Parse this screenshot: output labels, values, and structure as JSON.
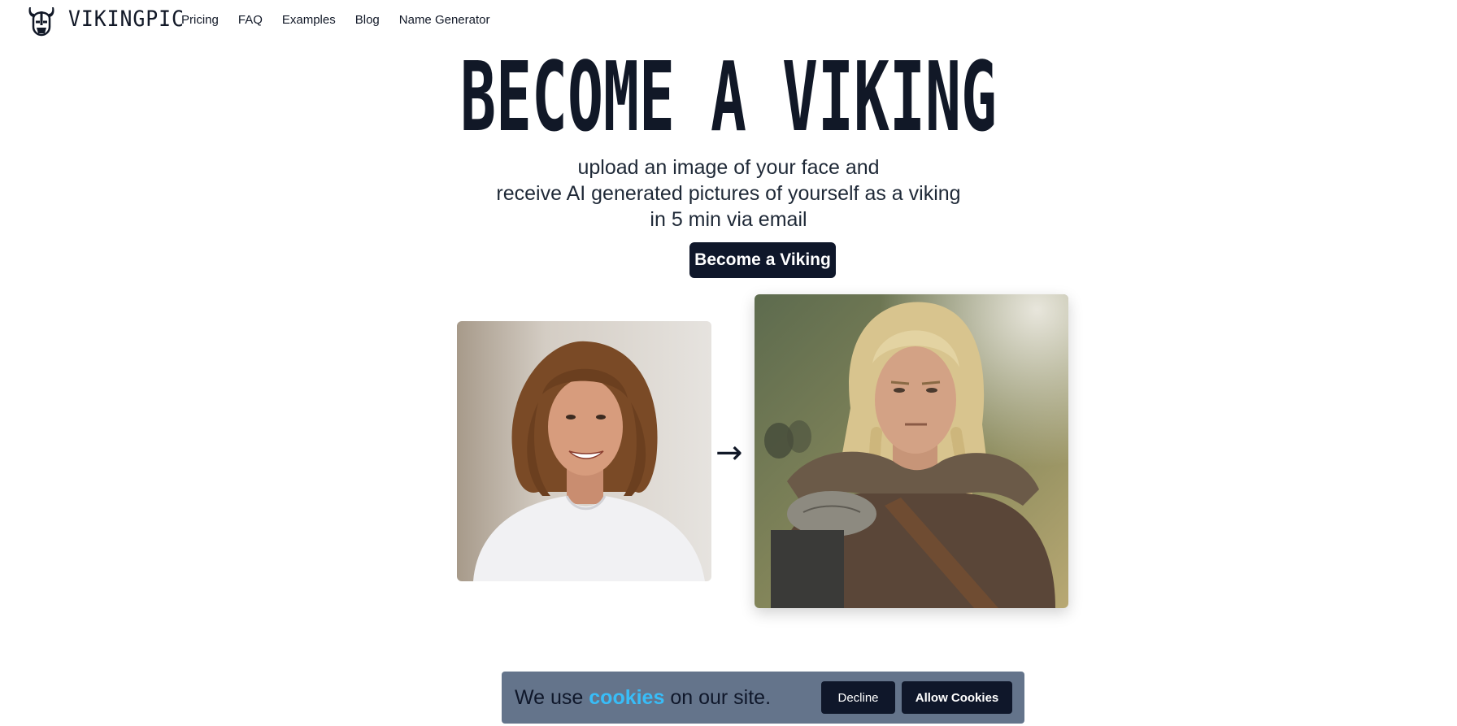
{
  "nav": {
    "brand_text": "VIKINGPIC",
    "brand_icon": "viking-helmet-icon",
    "links": [
      "Pricing",
      "FAQ",
      "Examples",
      "Blog",
      "Name Generator"
    ]
  },
  "hero": {
    "title": "BECOME A VIKING",
    "subtitle_lines": [
      "upload an image of your face and",
      "receive AI generated pictures of yourself as a viking",
      "in 5 min via email"
    ],
    "cta_label": "Become a Viking"
  },
  "comparison": {
    "arrow": "→",
    "before_image": "photo-of-smiling-man-with-long-hair-white-tshirt",
    "after_image": "ai-generated-viking-with-blond-braids-and-fur-armor"
  },
  "cookie_banner": {
    "text_before": "We use",
    "link": "cookies",
    "text_after": "on our site.",
    "decline_label": "Decline",
    "allow_label": "Allow Cookies"
  },
  "colors": {
    "primary_dark": "#0f172a",
    "cookie_bg": "#64748b",
    "cookie_link": "#38bdf8"
  }
}
